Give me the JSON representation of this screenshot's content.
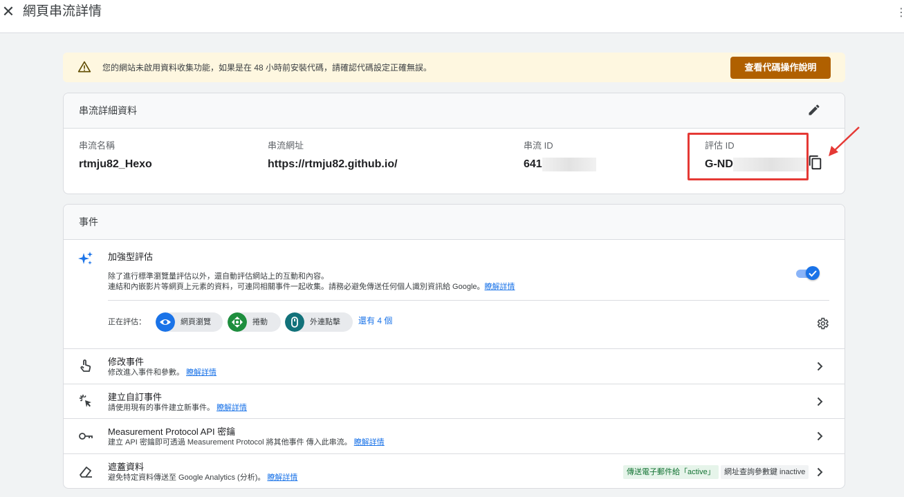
{
  "header": {
    "close_icon": "close-icon",
    "title": "網頁串流詳情",
    "menu_icon": "more-vert-icon"
  },
  "banner": {
    "icon": "warning-icon",
    "text": "您的網站未啟用資料收集功能，如果是在 48 小時前安裝代碼，請確認代碼設定正確無誤。",
    "button_label": "查看代碼操作說明",
    "button_color": "#b06000",
    "background": "#fef7e0"
  },
  "stream_details": {
    "heading": "串流詳細資料",
    "edit_icon": "pencil-icon",
    "fields": [
      {
        "label": "串流名稱",
        "value": "rtmju82_Hexo"
      },
      {
        "label": "串流網址",
        "value": "https://rtmju82.github.io/"
      },
      {
        "label": "串流 ID",
        "value": "641"
      },
      {
        "label": "評估 ID",
        "value": "G-ND"
      }
    ],
    "copy_icon": "copy-icon",
    "highlight_color": "#e53935"
  },
  "events": {
    "heading": "事件",
    "enhanced": {
      "icon": "sparkle-icon",
      "title": "加強型評估",
      "desc_line1": "除了進行標準瀏覽量評估以外，還自動評估網站上的互動和內容。",
      "desc_line2": "連結和內嵌影片等網頁上元素的資料，可連同相關事件一起收集。請務必避免傳送任何個人識別資訊給 Google。",
      "learn_more": "瞭解詳情",
      "toggle_on": true,
      "measuring_label": "正在評估：",
      "chips": [
        {
          "label": "網頁瀏覽",
          "icon": "eye-icon",
          "color": "#1a73e8"
        },
        {
          "label": "捲動",
          "icon": "scroll-icon",
          "color": "#1e8e3e"
        },
        {
          "label": "外連點擊",
          "icon": "mouse-icon",
          "color": "#12727a"
        }
      ],
      "more_link": "還有 4 個",
      "settings_icon": "gear-icon"
    },
    "rows": [
      {
        "icon": "touch-icon",
        "title": "修改事件",
        "desc": "修改進入事件和參數。",
        "learn_more": "瞭解詳情"
      },
      {
        "icon": "click-icon",
        "title": "建立自訂事件",
        "desc": "請使用現有的事件建立新事件。",
        "learn_more": "瞭解詳情"
      },
      {
        "icon": "key-icon",
        "title": "Measurement Protocol API 密鑰",
        "desc": "建立 API 密鑰即可透過 Measurement Protocol 將其他事件 傳入此串流。",
        "learn_more": "瞭解詳情"
      },
      {
        "icon": "eraser-icon",
        "title": "遮蓋資料",
        "desc": "避免特定資料傳送至 Google Analytics (分析)。",
        "learn_more": "瞭解詳情",
        "tags": [
          {
            "text": "傳送電子郵件給「active」",
            "bg": "#e6f4ea",
            "fg": "#137333"
          },
          {
            "text": "網址查詢參數鍵 inactive",
            "bg": "#f1f3f4",
            "fg": "#3c4043"
          }
        ]
      }
    ]
  }
}
